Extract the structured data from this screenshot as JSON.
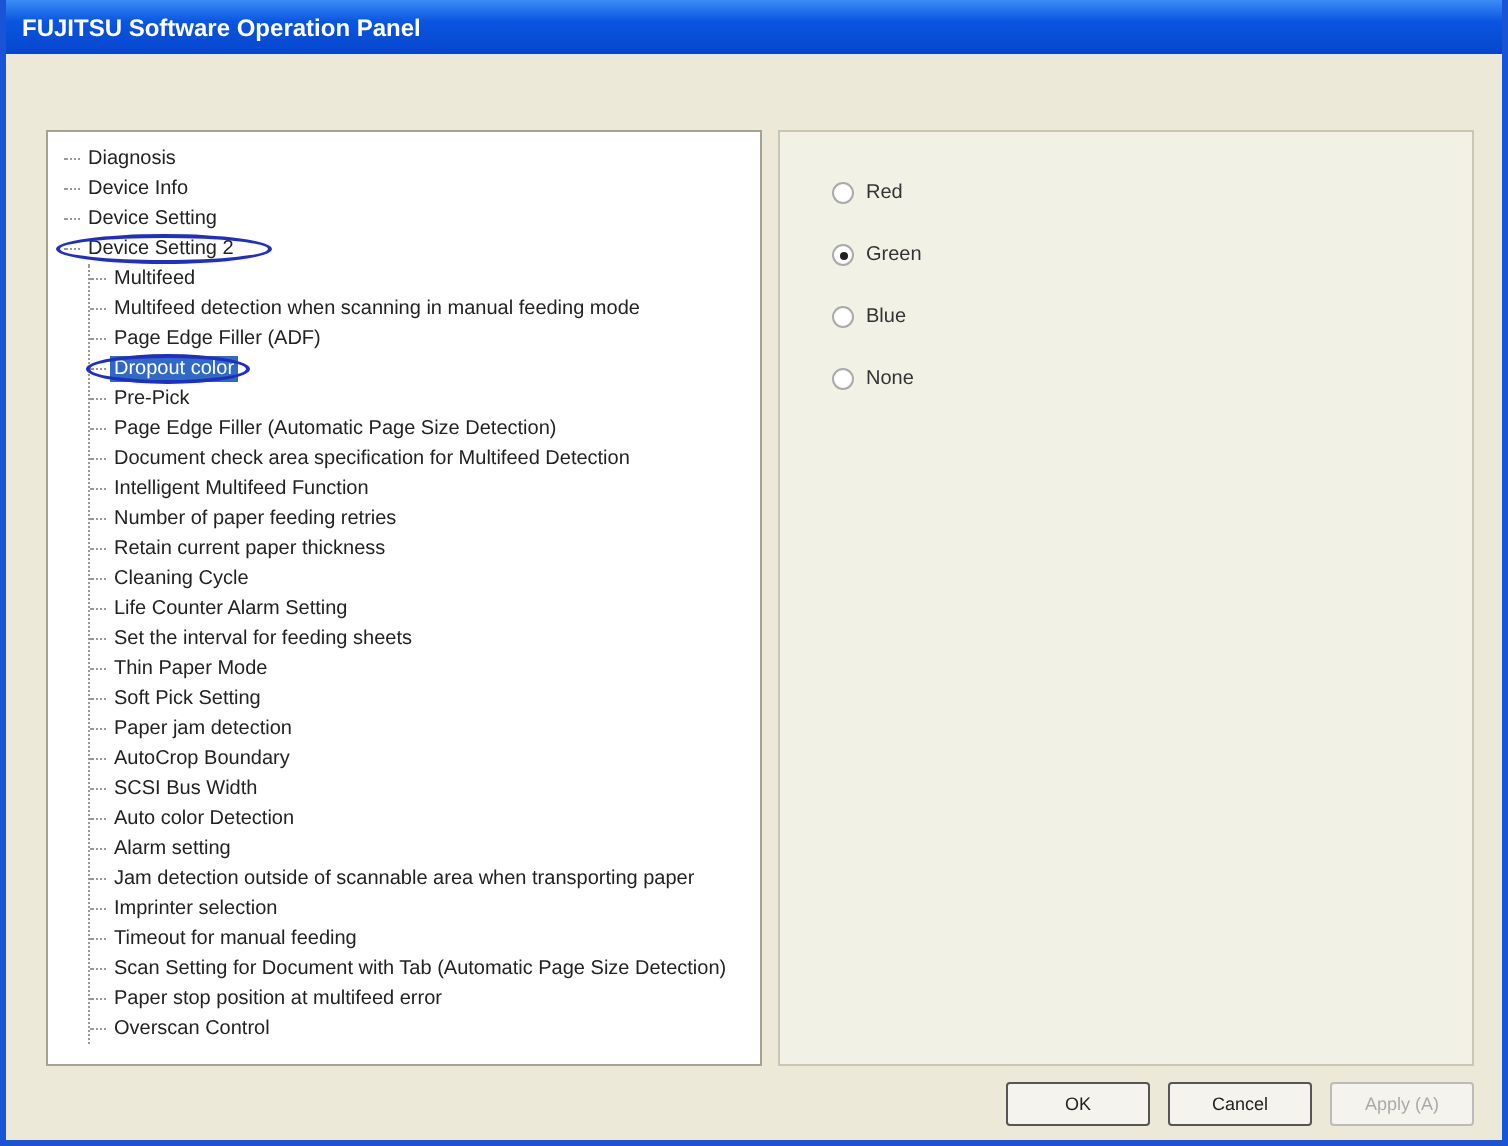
{
  "window": {
    "title": "FUJITSU Software Operation Panel"
  },
  "tree": [
    {
      "label": "Diagnosis",
      "selected": false,
      "circled": false
    },
    {
      "label": "Device Info",
      "selected": false,
      "circled": false
    },
    {
      "label": "Device Setting",
      "selected": false,
      "circled": false
    },
    {
      "label": "Device Setting 2",
      "selected": false,
      "circled": true,
      "expanded": true,
      "children": [
        {
          "label": "Multifeed",
          "selected": false,
          "circled": false
        },
        {
          "label": "Multifeed detection when scanning in manual feeding mode",
          "selected": false,
          "circled": false
        },
        {
          "label": "Page Edge Filler (ADF)",
          "selected": false,
          "circled": false
        },
        {
          "label": "Dropout color",
          "selected": true,
          "circled": true
        },
        {
          "label": "Pre-Pick",
          "selected": false,
          "circled": false
        },
        {
          "label": "Page Edge Filler (Automatic Page Size Detection)",
          "selected": false,
          "circled": false
        },
        {
          "label": "Document check area specification for Multifeed Detection",
          "selected": false,
          "circled": false
        },
        {
          "label": "Intelligent Multifeed Function",
          "selected": false,
          "circled": false
        },
        {
          "label": "Number of paper feeding retries",
          "selected": false,
          "circled": false
        },
        {
          "label": "Retain current paper thickness",
          "selected": false,
          "circled": false
        },
        {
          "label": "Cleaning Cycle",
          "selected": false,
          "circled": false
        },
        {
          "label": "Life Counter Alarm Setting",
          "selected": false,
          "circled": false
        },
        {
          "label": "Set the interval for feeding sheets",
          "selected": false,
          "circled": false
        },
        {
          "label": "Thin Paper Mode",
          "selected": false,
          "circled": false
        },
        {
          "label": "Soft Pick Setting",
          "selected": false,
          "circled": false
        },
        {
          "label": "Paper jam detection",
          "selected": false,
          "circled": false
        },
        {
          "label": "AutoCrop Boundary",
          "selected": false,
          "circled": false
        },
        {
          "label": "SCSI Bus Width",
          "selected": false,
          "circled": false
        },
        {
          "label": "Auto color Detection",
          "selected": false,
          "circled": false
        },
        {
          "label": "Alarm setting",
          "selected": false,
          "circled": false
        },
        {
          "label": "Jam detection outside of scannable area when transporting paper",
          "selected": false,
          "circled": false
        },
        {
          "label": "Imprinter selection",
          "selected": false,
          "circled": false
        },
        {
          "label": "Timeout for manual feeding",
          "selected": false,
          "circled": false
        },
        {
          "label": "Scan Setting for Document with Tab (Automatic Page Size Detection)",
          "selected": false,
          "circled": false
        },
        {
          "label": "Paper stop position at multifeed error",
          "selected": false,
          "circled": false
        },
        {
          "label": "Overscan Control",
          "selected": false,
          "circled": false
        }
      ]
    }
  ],
  "options": [
    {
      "label": "Red",
      "selected": false
    },
    {
      "label": "Green",
      "selected": true
    },
    {
      "label": "Blue",
      "selected": false
    },
    {
      "label": "None",
      "selected": false
    }
  ],
  "buttons": [
    {
      "label": "OK",
      "disabled": false
    },
    {
      "label": "Cancel",
      "disabled": false
    },
    {
      "label": "Apply (A)",
      "disabled": true
    }
  ]
}
